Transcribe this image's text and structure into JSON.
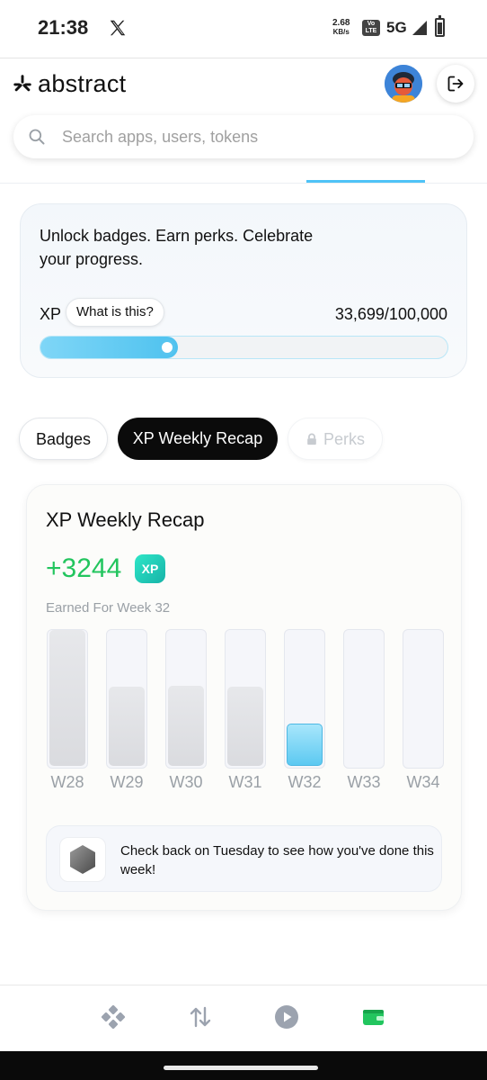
{
  "status_bar": {
    "time": "21:38",
    "net_speed_value": "2.68",
    "net_speed_unit": "KB/s",
    "volte_top": "Vo",
    "volte_bottom": "LTE",
    "network": "5G"
  },
  "header": {
    "brand": "abstract",
    "brand_color": "#111111"
  },
  "search": {
    "placeholder": "Search apps, users, tokens",
    "value": ""
  },
  "progress_card": {
    "tagline": "Unlock badges. Earn perks. Celebrate your progress.",
    "xp_label": "XP",
    "what_is_this": "What is this?",
    "xp_count": "33,699/100,000",
    "xp_current": 33699,
    "xp_total": 100000,
    "accent": "#4ec2ef"
  },
  "segments": {
    "badges": "Badges",
    "recap": "XP Weekly Recap",
    "perks": "Perks",
    "active": "recap"
  },
  "recap": {
    "title": "XP Weekly Recap",
    "amount": "+3244",
    "xp_badge": "XP",
    "earned_label": "Earned For Week 32",
    "amount_color": "#22c55e",
    "info_text": "Check back on Tuesday to see how you've done this week!"
  },
  "chart_data": {
    "type": "bar",
    "categories": [
      "W28",
      "W29",
      "W30",
      "W31",
      "W32",
      "W33",
      "W34"
    ],
    "values": [
      1.0,
      0.58,
      0.59,
      0.58,
      0.31,
      0,
      0
    ],
    "value_scale": "fraction of tallest bar",
    "highlight_category": "W32",
    "highlight_color": "#5cc9f1",
    "bar_color": "#dadbdf",
    "grid": false,
    "title": "",
    "xlabel": "",
    "ylabel": ""
  },
  "bottom_nav": {
    "items": [
      {
        "icon": "discover-icon",
        "active": false
      },
      {
        "icon": "swap-icon",
        "active": false
      },
      {
        "icon": "play-icon",
        "active": false
      },
      {
        "icon": "wallet-icon",
        "active": true
      }
    ],
    "active_color": "#22c55e",
    "inactive_color": "#9ca3af"
  }
}
